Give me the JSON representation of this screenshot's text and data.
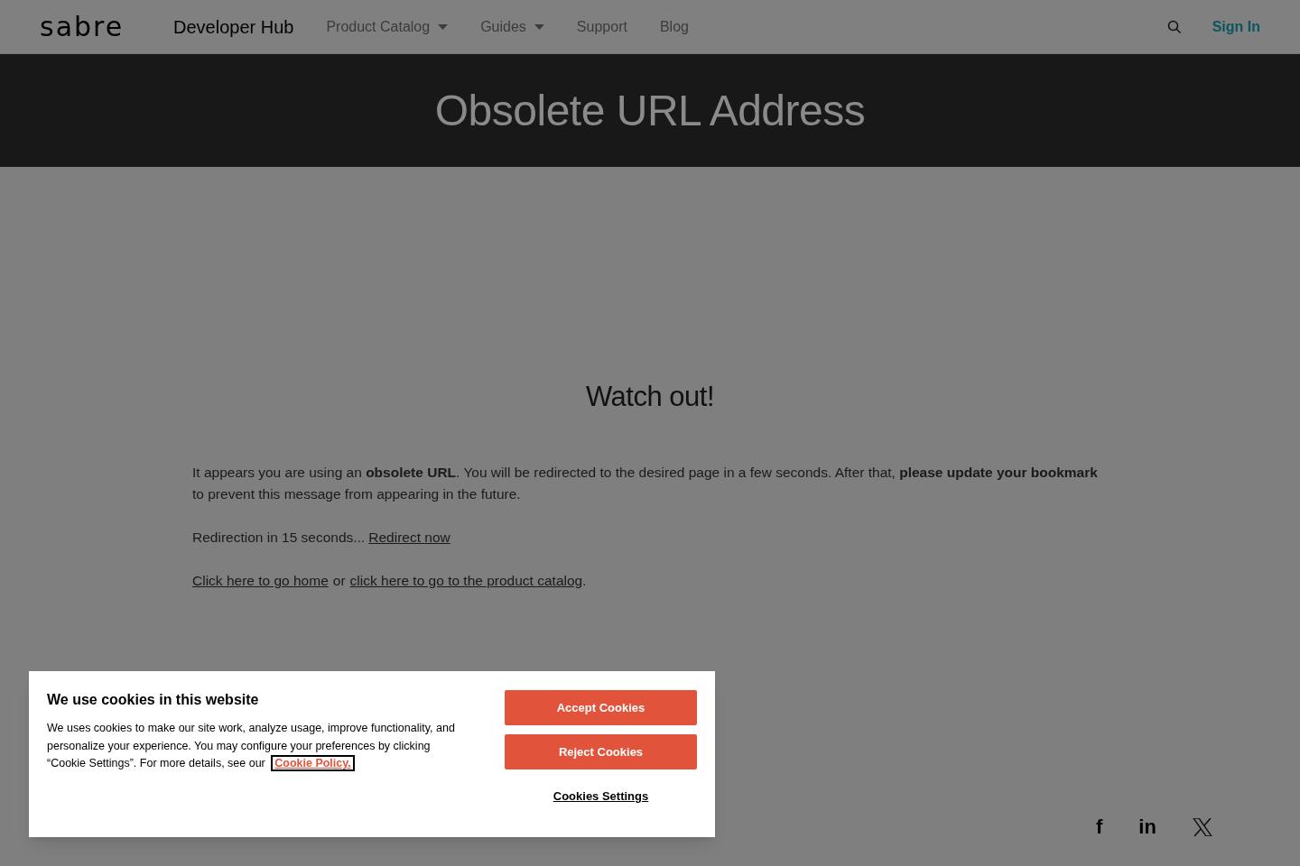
{
  "header": {
    "logo": "sabre",
    "site_name": "Developer Hub",
    "nav": [
      {
        "label": "Product Catalog",
        "dropdown": true
      },
      {
        "label": "Guides",
        "dropdown": true
      },
      {
        "label": "Support",
        "dropdown": false
      },
      {
        "label": "Blog",
        "dropdown": false
      }
    ],
    "sign_in": "Sign In"
  },
  "hero": {
    "title": "Obsolete URL Address"
  },
  "content": {
    "heading": "Watch out!",
    "message": "It appears you are using an **obsolete URL**. You will be redirected to the desired page in a few seconds. After that, **please update your bookmark** to prevent this message from appearing in the future.",
    "countdown": "Redirection in 15 seconds...",
    "redirect_link": "Redirect now",
    "home_link": "Click here to go home",
    "separator": "or",
    "catalog_link": "click here to go to the product catalog",
    "end": "."
  },
  "cookie_banner": {
    "title": "We use cookies in this website",
    "text": "We uses cookies to make our site work, analyze usage, improve functionality, and personalize your experience. You may configure your preferences by clicking “Cookie Settings”. For more details, see our",
    "policy_link": "Cookie Policy.",
    "buttons": [
      "Accept Cookies",
      "Reject Cookies"
    ],
    "settings_link": "Cookies Settings"
  },
  "social": [
    "f",
    "in"
  ]
}
